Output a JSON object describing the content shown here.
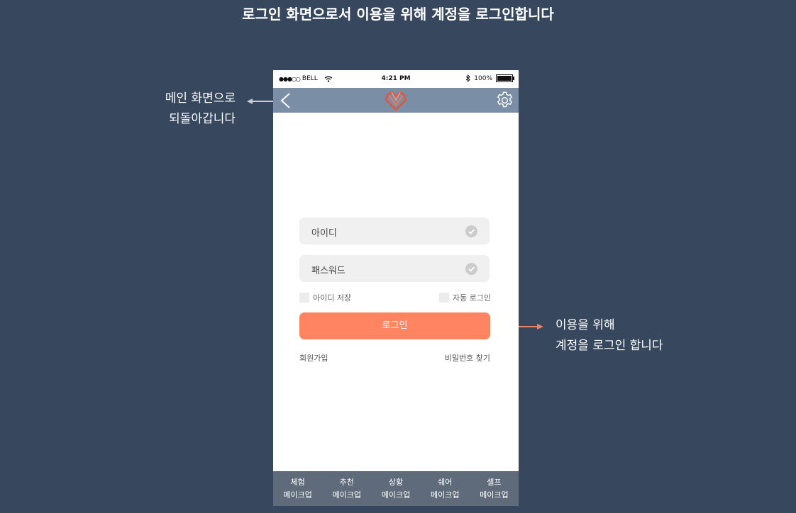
{
  "page": {
    "heading": "로그인 화면으로서 이용을 위해 계정을 로그인합니다"
  },
  "annotations": {
    "back": {
      "line1": "메인 화면으로",
      "line2": "되돌아갑니다"
    },
    "login": {
      "line1": "이용을 위해",
      "line2": "계정을 로그인 합니다"
    }
  },
  "status_bar": {
    "carrier": "BELL",
    "time": "4:21 PM",
    "battery": "100%"
  },
  "nav": {
    "back_icon": "chevron-left-icon",
    "logo_icon": "heart-logo-icon",
    "settings_icon": "gear-icon"
  },
  "form": {
    "id_label": "아이디",
    "password_label": "패스워드",
    "save_id_label": "아이디 저장",
    "auto_login_label": "자동 로그인",
    "login_button": "로그인",
    "signup_link": "회원가입",
    "find_password_link": "비밀번호 찾기"
  },
  "tabs": [
    {
      "line1": "체험",
      "line2": "메이크업"
    },
    {
      "line1": "추천",
      "line2": "메이크업"
    },
    {
      "line1": "상황",
      "line2": "메이크업"
    },
    {
      "line1": "쉐어",
      "line2": "메이크업"
    },
    {
      "line1": "셀프",
      "line2": "메이크업"
    }
  ],
  "colors": {
    "background": "#37475d",
    "nav_bar": "#7a8fa6",
    "accent": "#ff8562",
    "tab_bar": "#5f6b7a"
  }
}
